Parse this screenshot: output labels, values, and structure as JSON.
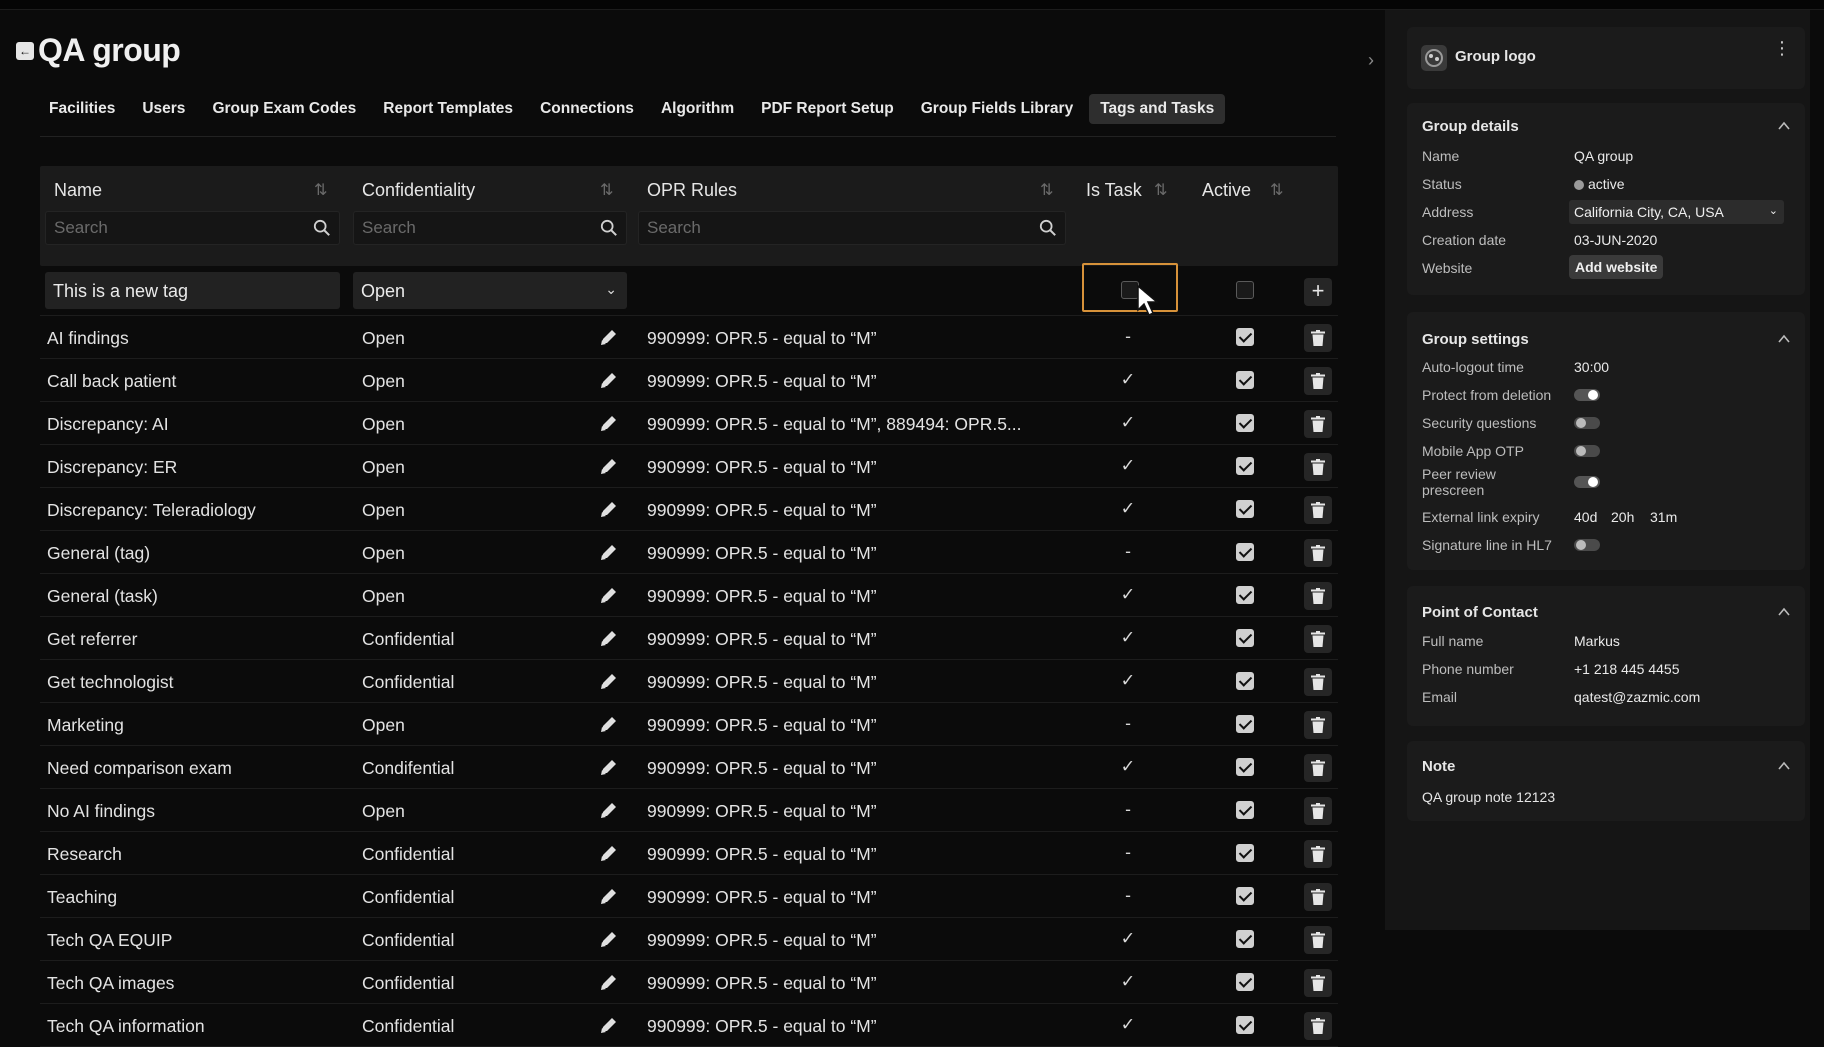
{
  "page": {
    "title": "QA group"
  },
  "tabs": [
    "Facilities",
    "Users",
    "Group Exam Codes",
    "Report Templates",
    "Connections",
    "Algorithm",
    "PDF Report Setup",
    "Group Fields Library",
    "Tags and Tasks"
  ],
  "table": {
    "columns": {
      "name": "Name",
      "confidentiality": "Confidentiality",
      "opr": "OPR Rules",
      "is_task": "Is Task",
      "active": "Active"
    },
    "search_placeholder": "Search",
    "new_row": {
      "name": "This is a new tag",
      "confidentiality": "Open"
    },
    "rows": [
      {
        "name": "AI findings",
        "conf": "Open",
        "opr": "990999: OPR.5 - equal to “M”",
        "task": "-",
        "active": true
      },
      {
        "name": "Call back patient",
        "conf": "Open",
        "opr": "990999: OPR.5 - equal to “M”",
        "task": "✓",
        "active": true
      },
      {
        "name": "Discrepancy: AI",
        "conf": "Open",
        "opr": "990999: OPR.5 - equal to “M”, 889494: OPR.5...",
        "task": "✓",
        "active": true
      },
      {
        "name": "Discrepancy: ER",
        "conf": "Open",
        "opr": "990999: OPR.5 - equal to “M”",
        "task": "✓",
        "active": true
      },
      {
        "name": "Discrepancy: Teleradiology",
        "conf": "Open",
        "opr": "990999: OPR.5 - equal to “M”",
        "task": "✓",
        "active": true
      },
      {
        "name": "General (tag)",
        "conf": "Open",
        "opr": "990999: OPR.5 - equal to “M”",
        "task": "-",
        "active": true
      },
      {
        "name": "General (task)",
        "conf": "Open",
        "opr": "990999: OPR.5 - equal to “M”",
        "task": "✓",
        "active": true
      },
      {
        "name": "Get referrer",
        "conf": "Confidential",
        "opr": "990999: OPR.5 - equal to “M”",
        "task": "✓",
        "active": true
      },
      {
        "name": "Get technologist",
        "conf": "Confidential",
        "opr": "990999: OPR.5 - equal to “M”",
        "task": "✓",
        "active": true
      },
      {
        "name": "Marketing",
        "conf": "Open",
        "opr": "990999: OPR.5 - equal to “M”",
        "task": "-",
        "active": true
      },
      {
        "name": "Need comparison exam",
        "conf": "Condifential",
        "opr": "990999: OPR.5 - equal to “M”",
        "task": "✓",
        "active": true
      },
      {
        "name": "No AI findings",
        "conf": "Open",
        "opr": "990999: OPR.5 - equal to “M”",
        "task": "-",
        "active": true
      },
      {
        "name": "Research",
        "conf": "Confidential",
        "opr": "990999: OPR.5 - equal to “M”",
        "task": "-",
        "active": true
      },
      {
        "name": "Teaching",
        "conf": "Confidential",
        "opr": "990999: OPR.5 - equal to “M”",
        "task": "-",
        "active": true
      },
      {
        "name": "Tech QA EQUIP",
        "conf": "Confidential",
        "opr": "990999: OPR.5 - equal to “M”",
        "task": "✓",
        "active": true
      },
      {
        "name": "Tech QA images",
        "conf": "Confidential",
        "opr": "990999: OPR.5 - equal to “M”",
        "task": "✓",
        "active": true
      },
      {
        "name": "Tech QA information",
        "conf": "Confidential",
        "opr": "990999: OPR.5 - equal to “M”",
        "task": "✓",
        "active": true
      }
    ]
  },
  "sidebar": {
    "logo": {
      "title": "Group logo"
    },
    "details": {
      "title": "Group details",
      "name_label": "Name",
      "name_value": "QA group",
      "status_label": "Status",
      "status_value": "active",
      "address_label": "Address",
      "address_value": "California City, CA, USA",
      "creation_label": "Creation date",
      "creation_value": "03-JUN-2020",
      "website_label": "Website",
      "website_button": "Add website"
    },
    "settings": {
      "title": "Group settings",
      "autologout_label": "Auto-logout time",
      "autologout_value": "30:00",
      "protect_label": "Protect from deletion",
      "protect_on": true,
      "security_label": "Security questions",
      "security_on": false,
      "otp_label": "Mobile App OTP",
      "otp_on": false,
      "peer_label_1": "Peer review",
      "peer_label_2": "prescreen",
      "peer_on": true,
      "expiry_label": "External link expiry",
      "expiry_d": "40d",
      "expiry_h": "20h",
      "expiry_m": "31m",
      "sigline_label": "Signature line in HL7",
      "sigline_on": false
    },
    "contact": {
      "title": "Point of Contact",
      "fullname_label": "Full name",
      "fullname_value": "Markus",
      "phone_label": "Phone number",
      "phone_value": "+1 218 445 4455",
      "email_label": "Email",
      "email_value": "qatest@zazmic.com"
    },
    "note": {
      "title": "Note",
      "text": "QA group note 12123"
    }
  }
}
